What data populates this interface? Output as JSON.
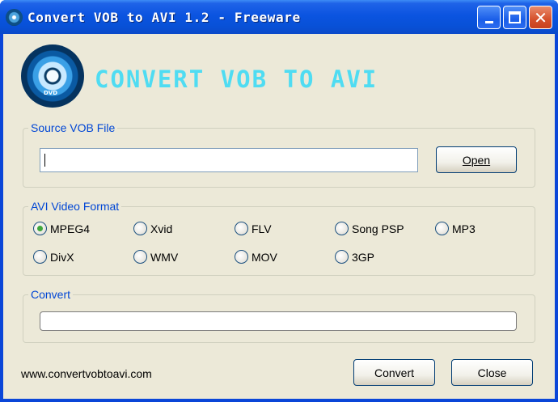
{
  "window": {
    "title": "Convert VOB to AVI 1.2 - Freeware",
    "minimize_icon": "minimize-icon",
    "maximize_icon": "maximize-icon",
    "close_icon": "close-icon",
    "close_glyph": "✕"
  },
  "logo": {
    "text": "CONVERT VOB TO AVI",
    "disc_label": "DVD"
  },
  "source": {
    "group_label": "Source VOB File",
    "input_value": "",
    "open_label": "Open"
  },
  "format": {
    "group_label": "AVI Video Format",
    "selected": "MPEG4",
    "options": [
      "MPEG4",
      "Xvid",
      "FLV",
      "Song PSP",
      "MP3",
      "DivX",
      "WMV",
      "MOV",
      "3GP"
    ]
  },
  "convert": {
    "group_label": "Convert",
    "progress": 0
  },
  "footer": {
    "website": "www.convertvobtoavi.com",
    "convert_label": "Convert",
    "close_label": "Close"
  },
  "colors": {
    "title_bar": "#0851d8",
    "group_label": "#0046d5",
    "logo_text": "#4fdcf2",
    "radio_selected": "#3fa73c",
    "face": "#ece9d8"
  }
}
